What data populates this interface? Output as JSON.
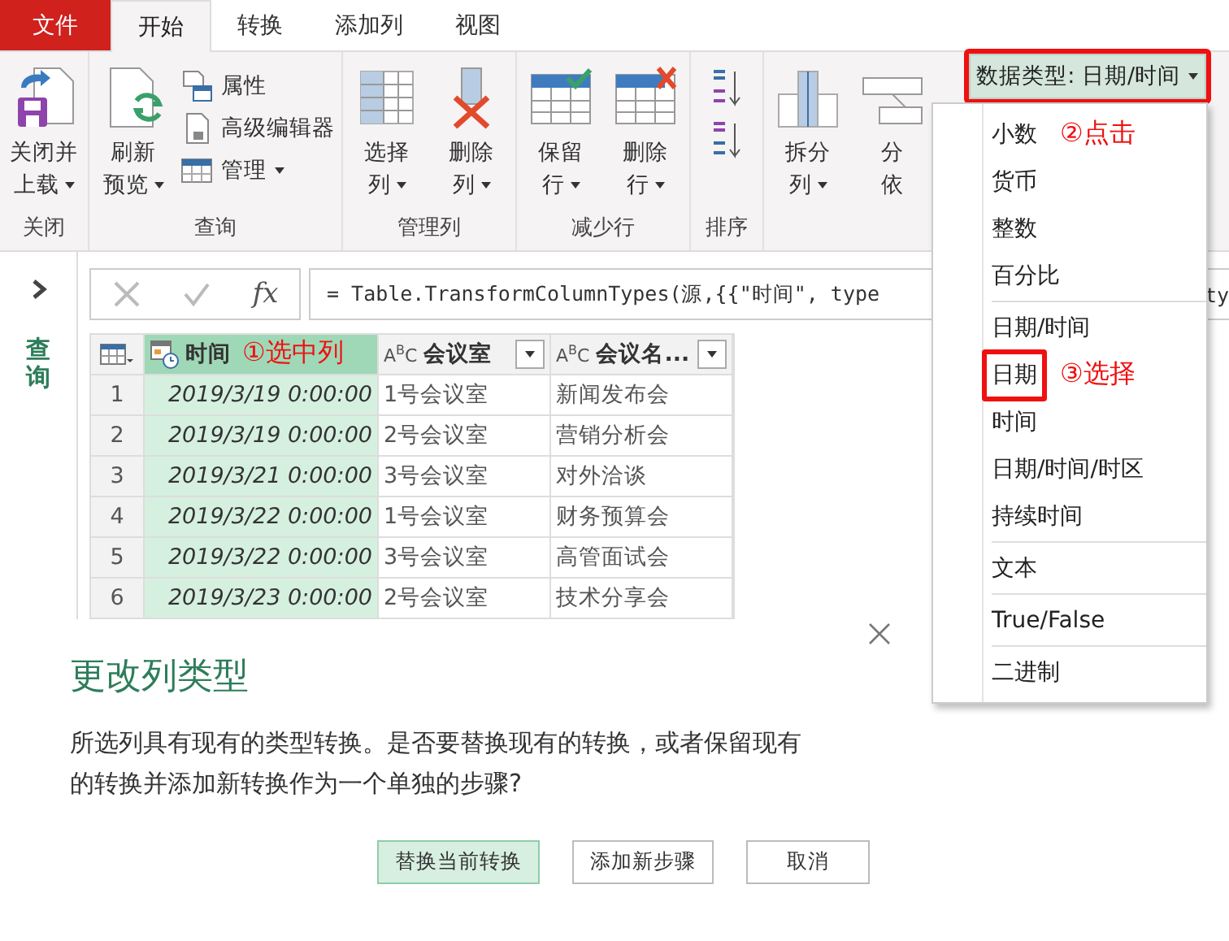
{
  "tabs": [
    {
      "label": "文件",
      "kind": "file",
      "selected": false
    },
    {
      "label": "开始",
      "kind": "tab",
      "selected": true
    },
    {
      "label": "转换",
      "kind": "tab",
      "selected": false
    },
    {
      "label": "添加列",
      "kind": "tab",
      "selected": false
    },
    {
      "label": "视图",
      "kind": "tab",
      "selected": false
    }
  ],
  "ribbon": {
    "groups": [
      {
        "label": "关闭",
        "items": [
          {
            "kind": "large",
            "lines": [
              "关闭并",
              "上载"
            ],
            "dropdown": true
          }
        ]
      },
      {
        "label": "查询",
        "items": [
          {
            "kind": "large",
            "lines": [
              "刷新",
              "预览"
            ],
            "dropdown": true
          },
          {
            "kind": "stack",
            "entries": [
              {
                "label": "属性",
                "dropdown": false
              },
              {
                "label": "高级编辑器",
                "dropdown": false
              },
              {
                "label": "管理",
                "dropdown": true
              }
            ]
          }
        ]
      },
      {
        "label": "管理列",
        "items": [
          {
            "kind": "large",
            "lines": [
              "选择",
              "列"
            ],
            "dropdown": true
          },
          {
            "kind": "large",
            "lines": [
              "删除",
              "列"
            ],
            "dropdown": true
          }
        ]
      },
      {
        "label": "减少行",
        "items": [
          {
            "kind": "large",
            "lines": [
              "保留",
              "行"
            ],
            "dropdown": true
          },
          {
            "kind": "large",
            "lines": [
              "删除",
              "行"
            ],
            "dropdown": true
          }
        ]
      },
      {
        "label": "排序",
        "items": [
          {
            "kind": "sort"
          }
        ]
      },
      {
        "items": [
          {
            "kind": "large",
            "lines": [
              "拆分",
              "列"
            ],
            "dropdown": true
          },
          {
            "kind": "large",
            "lines": [
              "分",
              "依"
            ],
            "dropdown": false
          }
        ]
      }
    ],
    "data_type": {
      "label": "数据类型: 日期/时间",
      "dropdown": true,
      "highlighted": true
    }
  },
  "sidebar": {
    "title": "查询"
  },
  "formula": {
    "fx": "fx",
    "text": "= Table.TransformColumnTypes(源,{{\"时间\", type",
    "tail": "ty"
  },
  "table": {
    "columns": [
      {
        "name": "时间",
        "kind": "datetime",
        "selected": true,
        "filter": false,
        "annotation": "①选中列"
      },
      {
        "name": "会议室",
        "kind": "text",
        "type_label": "A$^{B}$C",
        "selected": false,
        "filter": true
      },
      {
        "name": "会议名...",
        "kind": "text",
        "type_label": "A$^{B}$C",
        "selected": false,
        "filter": true
      }
    ],
    "rows": [
      {
        "number": "1",
        "cells": [
          "2019/3/19 0:00:00",
          "1号会议室",
          "新闻发布会"
        ]
      },
      {
        "number": "2",
        "cells": [
          "2019/3/19 0:00:00",
          "2号会议室",
          "营销分析会"
        ]
      },
      {
        "number": "3",
        "cells": [
          "2019/3/21 0:00:00",
          "3号会议室",
          "对外洽谈"
        ]
      },
      {
        "number": "4",
        "cells": [
          "2019/3/22 0:00:00",
          "1号会议室",
          "财务预算会"
        ]
      },
      {
        "number": "5",
        "cells": [
          "2019/3/22 0:00:00",
          "3号会议室",
          "高管面试会"
        ]
      },
      {
        "number": "6",
        "cells": [
          "2019/3/23 0:00:00",
          "2号会议室",
          "技术分享会"
        ]
      }
    ]
  },
  "menu": {
    "items": [
      {
        "label": "小数",
        "highlighted": false,
        "annotation": "②点击"
      },
      {
        "label": "货币",
        "highlighted": false
      },
      {
        "label": "整数",
        "highlighted": false
      },
      {
        "label": "百分比",
        "highlighted": false,
        "separator_after": true
      },
      {
        "label": "日期/时间",
        "highlighted": false
      },
      {
        "label": "日期",
        "highlighted": true,
        "annotation": "③选择"
      },
      {
        "label": "时间",
        "highlighted": false
      },
      {
        "label": "日期/时间/时区",
        "highlighted": false
      },
      {
        "label": "持续时间",
        "highlighted": false,
        "separator_after": true
      },
      {
        "label": "文本",
        "highlighted": false,
        "separator_after": true
      },
      {
        "label": "True/False",
        "highlighted": false,
        "separator_after": true
      },
      {
        "label": "二进制",
        "highlighted": false
      }
    ]
  },
  "dialog": {
    "title": "更改列类型",
    "message_lines": [
      "所选列具有现有的类型转换。是否要替换现有的转换，或者保留现有",
      "的转换并添加新转换作为一个单独的步骤?"
    ],
    "buttons": [
      {
        "label": "替换当前转换",
        "default": true
      },
      {
        "label": "添加新步骤",
        "default": false
      },
      {
        "label": "取消",
        "default": false
      }
    ]
  }
}
